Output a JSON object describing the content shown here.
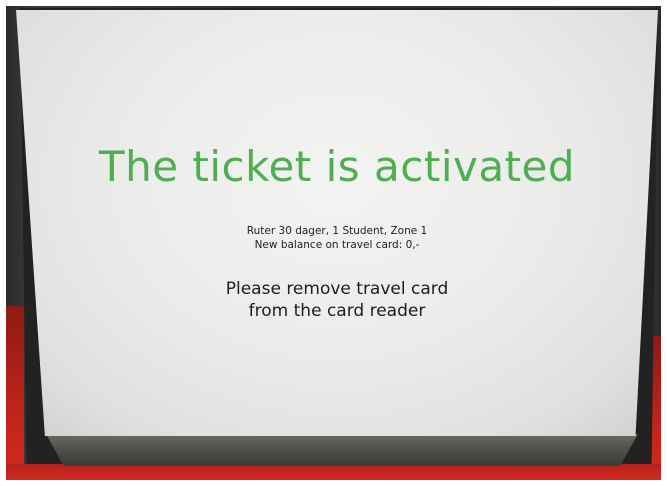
{
  "screen": {
    "headline": "The ticket is activated",
    "details": [
      "Ruter 30 dager, 1 Student, Zone 1",
      "New balance on travel card: 0,-"
    ],
    "instruction_lines": [
      "Please remove travel card",
      "from the card reader"
    ]
  },
  "colors": {
    "headline": "#4fae52",
    "housing_red": "#d42a20",
    "bezel": "#222222",
    "screen_bg": "#ececea"
  }
}
